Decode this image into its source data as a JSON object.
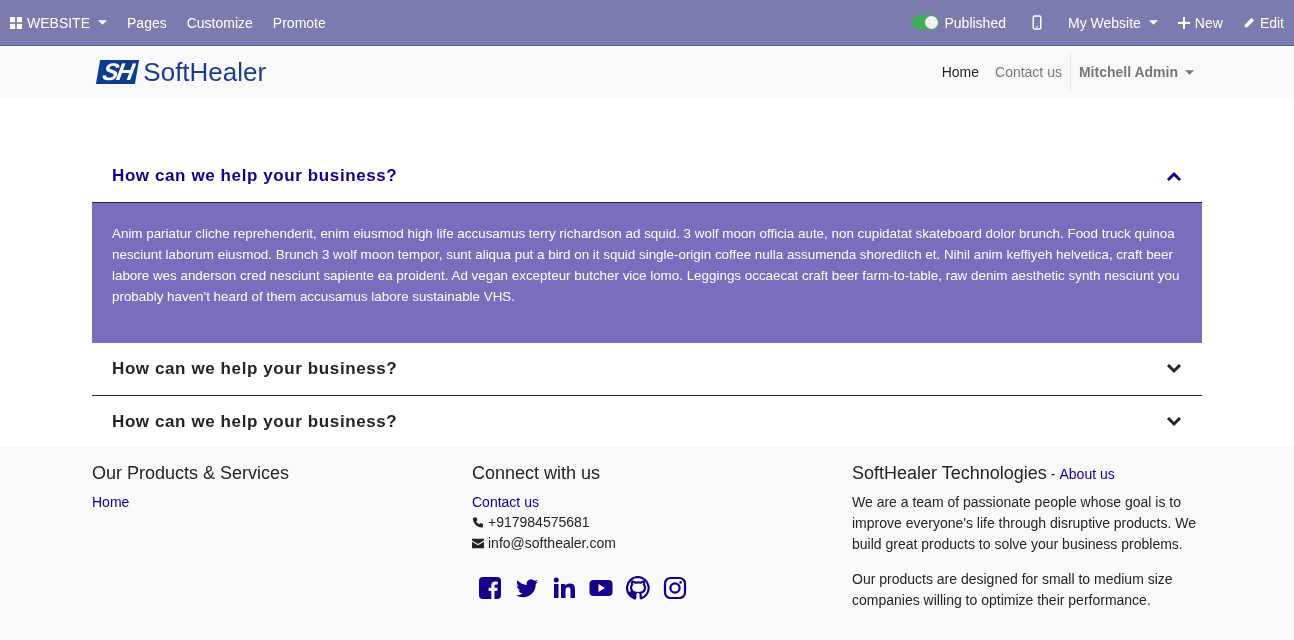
{
  "admin_bar": {
    "app_menu": "WEBSITE",
    "left_items": [
      "Pages",
      "Customize",
      "Promote"
    ],
    "published": {
      "label": "Published",
      "on": true
    },
    "website_menu": "My Website",
    "new_button": "New",
    "edit_button": "Edit"
  },
  "header": {
    "logo_mark": "SH",
    "logo_text": "SoftHealer",
    "nav": [
      {
        "label": "Home",
        "selected": true
      },
      {
        "label": "Contact us",
        "selected": false
      }
    ],
    "user_menu": "Mitchell Admin"
  },
  "accordion": [
    {
      "title": "How can we help your business?",
      "expanded": true,
      "body": "Anim pariatur cliche reprehenderit, enim eiusmod high life accusamus terry richardson ad squid. 3 wolf moon officia aute, non cupidatat skateboard dolor brunch. Food truck quinoa nesciunt laborum eiusmod. Brunch 3 wolf moon tempor, sunt aliqua put a bird on it squid single-origin coffee nulla assumenda shoreditch et. Nihil anim keffiyeh helvetica, craft beer labore wes anderson cred nesciunt sapiente ea proident. Ad vegan excepteur butcher vice lomo. Leggings occaecat craft beer farm-to-table, raw denim aesthetic synth nesciunt you probably haven't heard of them accusamus labore sustainable VHS."
    },
    {
      "title": "How can we help your business?",
      "expanded": false
    },
    {
      "title": "How can we help your business?",
      "expanded": false
    }
  ],
  "footer": {
    "products": {
      "title": "Our Products & Services",
      "links": [
        "Home"
      ]
    },
    "connect": {
      "title": "Connect with us",
      "link": "Contact us",
      "phone": "+917984575681",
      "email": "info@softhealer.com",
      "social": [
        {
          "kind": "facebook"
        },
        {
          "kind": "twitter"
        },
        {
          "kind": "linkedin"
        },
        {
          "kind": "youtube"
        },
        {
          "kind": "github"
        },
        {
          "kind": "instagram"
        }
      ]
    },
    "about": {
      "title": "SoftHealer Technologies",
      "separator": "-",
      "link": "About us",
      "paragraphs": [
        "We are a team of passionate people whose goal is to improve everyone's life through disruptive products. We build great products to solve your business problems.",
        "Our products are designed for small to medium size companies willing to optimize their performance."
      ]
    }
  }
}
